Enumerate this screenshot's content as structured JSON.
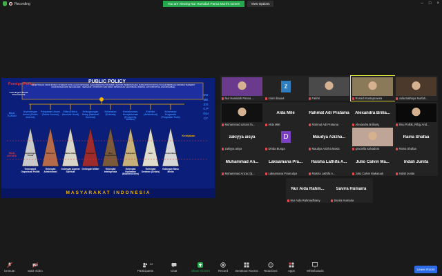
{
  "topbar": {
    "recording_label": "Recording",
    "banner": "You are viewing Nur Hamidah Panca Murti's screen",
    "view_options": "View Options"
  },
  "slide": {
    "title": "PUBLIC POLICY",
    "foreign_policy": "Foreign Policy",
    "luar_negeri": "Luar Negeri/ Dunia Internasional",
    "domestic_policy": "DOMESTIC POLICY",
    "header_text": "KEPENTINGAN UMUM (PUBLIC INTEREST) DIOLAH DAN DIPROSES OLEH MESIN POLITIK RESMI / SEKTOR PEMERINTAHAN/ SUPRASTRUKTUR POLITIK DARI BERBAGAI ASPIRASI TERSEBUT (DIAKOMODASIKAN SECARA ARIF... MENGIKAT, OTORITATIF DAN DAPAT DIPAKSAKAN (LEGITIMATE, BINDING, AUTHORITATIVE, ENFORCEABLE)",
    "nilai_tujuan": "NILAI TUJUAN",
    "nilai_antara": "NILAI ANTARA",
    "kebijakan": "Kebijakan",
    "footer": "MASYARAKAT INDONESIA",
    "values": [
      {
        "top": "Kepentingan Umum (Public Interest)",
        "mid": "Kepentingan Politik",
        "bottom": "Golongan2 Organisasi Politik"
      },
      {
        "top": "Pelayanan Umum (Public Service)",
        "mid": "Efisiensi",
        "bottom": "Golongan Administrasi"
      },
      {
        "top": "Etika (Ethics, Absolute Good)",
        "mid": "Makna Hidup",
        "bottom": "Golongan Agama/ Spiritual"
      },
      {
        "top": "Kelangsungan Hidup (National Survival)",
        "mid": "Kekuatan",
        "bottom": "Golongan Militer"
      },
      {
        "top": "Kebenaran (Scientia)",
        "mid": "Ilmu Pengetahuan",
        "bottom": "Golongan Intelegensia"
      },
      {
        "top": "Kemakmuran, Kesejahteraan (Prosperity, Welfare)",
        "mid": "Kekayaan",
        "bottom": "Golongan Usahawan (Business men)"
      },
      {
        "top": "Estetika (Aesthetical)",
        "mid": "Seni",
        "bottom": "Golongan Seniman (Artists)"
      },
      {
        "top": "Kebenaran Pragmatik (Pragmatic Truth)",
        "mid": "Komunikasi",
        "bottom": "Golongan Mass Media"
      }
    ]
  },
  "participants": [
    {
      "name": "Nur Hamidah Panca ...",
      "kind": "video",
      "color": "#6a3b8c"
    },
    {
      "name": "zoom baaa4",
      "kind": "avatar",
      "letter": "z",
      "color": "#2e7dbf"
    },
    {
      "name": "Fakhri",
      "kind": "video",
      "color": "#4a4a4a"
    },
    {
      "name": "Rusadi Kantaprawira",
      "kind": "video",
      "color": "#8a7a5a",
      "speaking": true
    },
    {
      "name": "Julia Bathsya Nurfah...",
      "kind": "video",
      "color": "#4b3a2c"
    },
    {
      "name": "Muhammad azzam fa...",
      "kind": "video",
      "color": "#111111"
    },
    {
      "name": "Alda Mile",
      "kind": "name",
      "big": "Alda Mile"
    },
    {
      "name": "Rahmat Adi Pratama",
      "kind": "name",
      "big": "Rahmat Adi Pratama"
    },
    {
      "name": "Alexandra Brilianty",
      "kind": "name",
      "big": "Alexandra Brilia..."
    },
    {
      "name": "Ilmu Politik_Rifqy And...",
      "kind": "video",
      "color": "#0a0a0a"
    },
    {
      "name": "zakiyya aisya",
      "kind": "name",
      "big": "zakiyya aisya"
    },
    {
      "name": "Dinda Bunga",
      "kind": "avatar",
      "letter": "D",
      "color": "#7b3fc4"
    },
    {
      "name": "Maudya Azizha Masic",
      "kind": "name",
      "big": "Maudya Azizha..."
    },
    {
      "name": "graciella salvadora",
      "kind": "video",
      "color": "#bfa598"
    },
    {
      "name": "Raina Shafaa",
      "kind": "name",
      "big": "Raina Shafaa"
    },
    {
      "name": "Muhammad Anzac Dj...",
      "kind": "name",
      "big": "Muhammad An..."
    },
    {
      "name": "Laksamana Pramudya",
      "kind": "name",
      "big": "Laksamana Pra..."
    },
    {
      "name": "Raisha Lathifa A...",
      "kind": "name",
      "big": "Raisha Lathifa A..."
    },
    {
      "name": "Julio Calvin Makatuuk",
      "kind": "name",
      "big": "Julio Calvin Ma..."
    },
    {
      "name": "Indah Junita",
      "kind": "name",
      "big": "Indah Junita"
    },
    {
      "name": "Nur Aida Rahmadhiany",
      "kind": "name",
      "big": "Nur Aida Rahm..."
    },
    {
      "name": "Savira Humaira",
      "kind": "name",
      "big": "Savira Humaira"
    }
  ],
  "toolbar": {
    "unmute": "Unmute",
    "start_video": "Start Video",
    "participants": "Participants",
    "participants_count": "22",
    "chat": "Chat",
    "share_screen": "Share Screen",
    "record": "Record",
    "breakout": "Breakout Rooms",
    "reactions": "Reactions",
    "apps": "Apps",
    "whiteboards": "Whiteboards",
    "leave": "Leave Room"
  },
  "colors": {
    "banner": "#25a84a",
    "leave": "#2d6ce6",
    "slide_bg": "#0b1e7a",
    "slide_accent": "#f7b500",
    "speaking_border": "#e5e53a"
  }
}
